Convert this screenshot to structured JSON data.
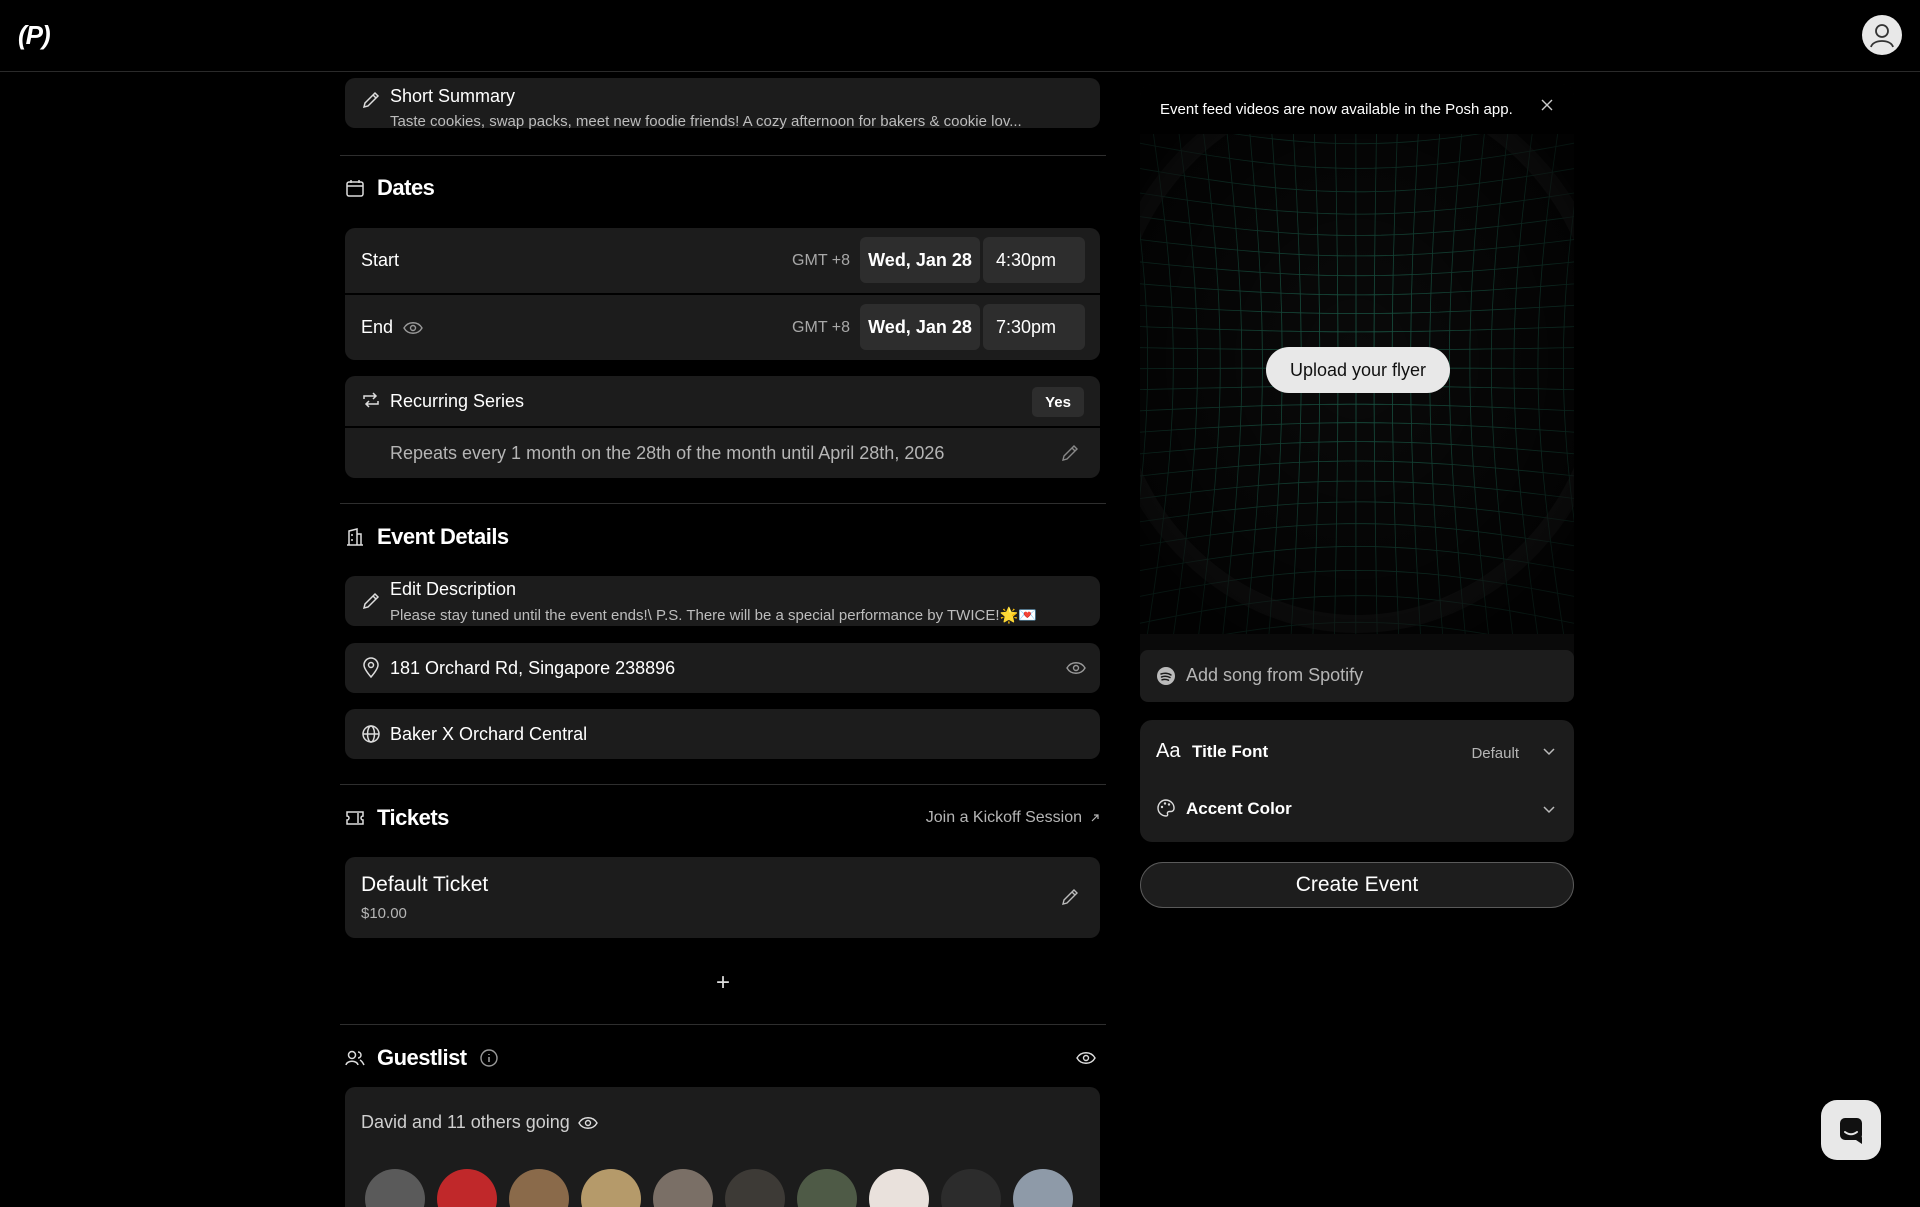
{
  "app": {
    "logo": "(P)"
  },
  "summary": {
    "title": "Short Summary",
    "text": "Taste cookies, swap packs, meet new foodie friends! A cozy afternoon for bakers & cookie lov..."
  },
  "dates": {
    "title": "Dates",
    "start": {
      "label": "Start",
      "tz": "GMT +8",
      "date": "Wed, Jan 28",
      "time": "4:30pm"
    },
    "end": {
      "label": "End",
      "tz": "GMT +8",
      "date": "Wed, Jan 28",
      "time": "7:30pm"
    },
    "recurring": {
      "label": "Recurring Series",
      "value": "Yes",
      "description": "Repeats every 1 month on the 28th of the month until April 28th, 2026"
    }
  },
  "event_details": {
    "title": "Event Details",
    "description": {
      "label": "Edit Description",
      "text": "Please stay tuned until the event ends!\\ P.S. There will be a special performance by TWICE!🌟💌"
    },
    "address": "181 Orchard Rd, Singapore 238896",
    "venue": "Baker X Orchard Central"
  },
  "tickets": {
    "title": "Tickets",
    "kickoff_link": "Join a Kickoff Session",
    "items": [
      {
        "name": "Default Ticket",
        "price": "$10.00"
      }
    ],
    "add_symbol": "+"
  },
  "guestlist": {
    "title": "Guestlist",
    "going_text": "David and 11 others going"
  },
  "flyer": {
    "banner": "Event feed videos are now available in the Posh app.",
    "upload_label": "Upload your flyer"
  },
  "spotify": {
    "placeholder": "Add song from Spotify"
  },
  "title_font": {
    "aa": "Aa",
    "label": "Title Font",
    "value": "Default"
  },
  "accent_color": {
    "label": "Accent Color"
  },
  "create_event": "Create Event",
  "colors": {
    "background": "#000000",
    "card": "#1c1c1c",
    "chip": "#2d2d2d",
    "grid": "#1f6b55"
  }
}
